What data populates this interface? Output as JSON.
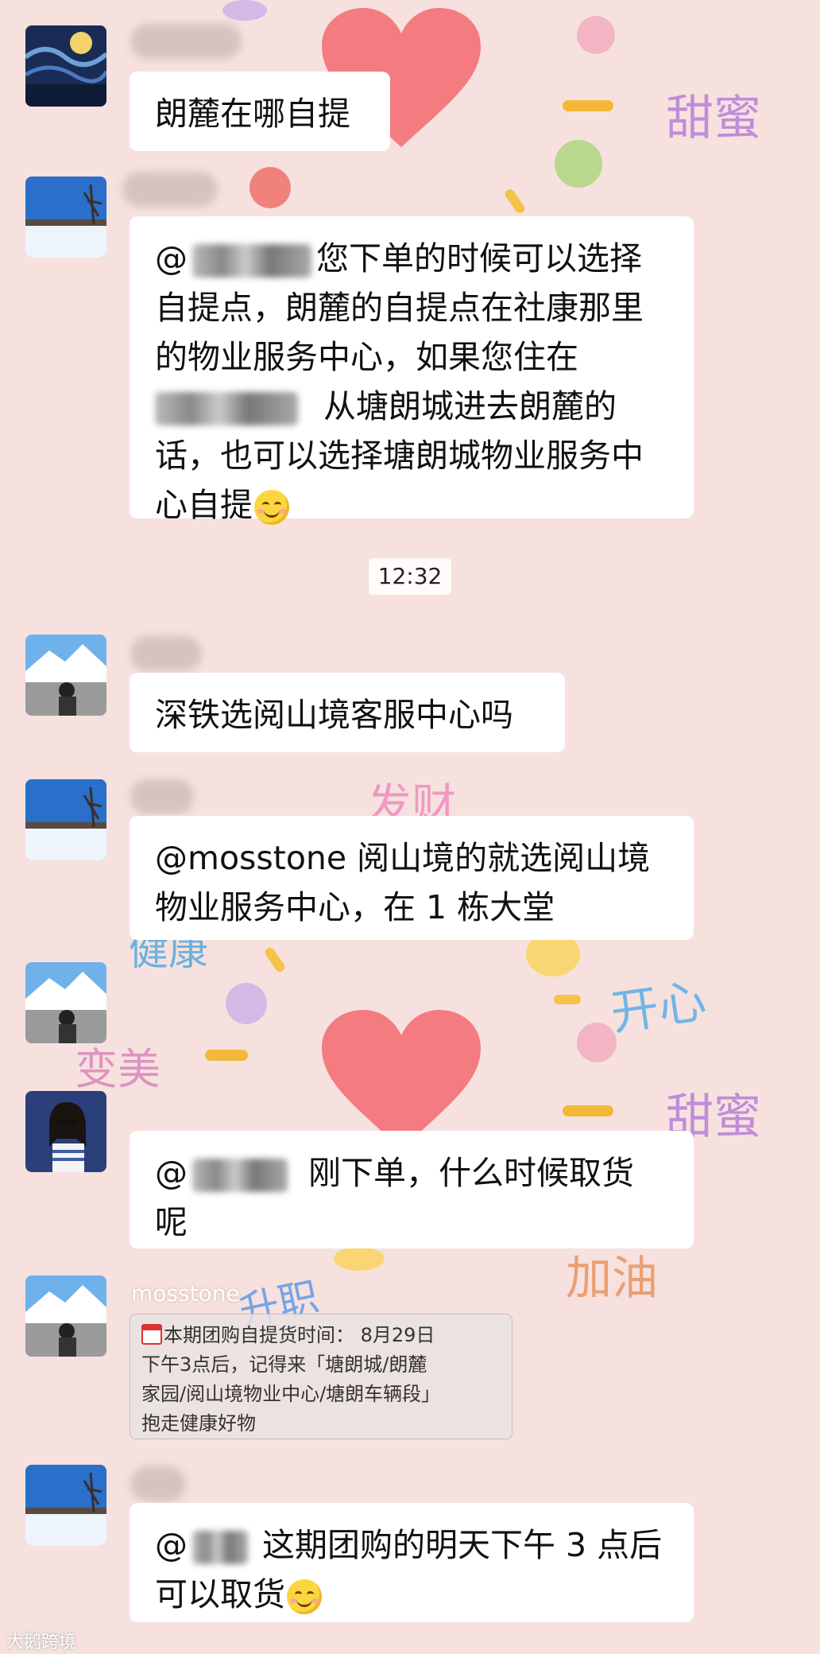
{
  "colors": {
    "background": "#f6e1df",
    "bubble": "#ffffff",
    "heart": "#f47c80"
  },
  "decorations": {
    "words": [
      "甜蜜",
      "发财",
      "健康",
      "开心",
      "变美",
      "甜蜜",
      "加油",
      "升职"
    ]
  },
  "messages": [
    {
      "text": "朗麓在哪自提"
    },
    {
      "lines": [
        "@",
        "您下单的时候可以选择",
        "自提点，朗麓的自提点在社康那里",
        "的物业服务中心，如果您住在",
        "从塘朗城进去朗麓的",
        "话，也可以选择塘朗城物业服务中",
        "心自提"
      ]
    },
    {
      "text": "深铁选阅山境客服中心吗"
    },
    {
      "lines": [
        "@mosstone 阅山境的就选阅山境",
        "物业服务中心，在 1 栋大堂"
      ]
    },
    {
      "lines": [
        "@",
        "刚下单，什么时候取货",
        "呢"
      ]
    },
    {
      "sender": "mosstone",
      "notice": [
        "本期团购自提货时间： 8月29日",
        "下午3点后，记得来「塘朗城/朗麓",
        "家园/阅山境物业中心/塘朗车辆段」",
        "抱走健康好物"
      ]
    },
    {
      "lines": [
        "@",
        "这期团购的明天下午 3 点后",
        "可以取货"
      ]
    }
  ],
  "timestamp": "12:32",
  "watermark": "大鹅跨境"
}
